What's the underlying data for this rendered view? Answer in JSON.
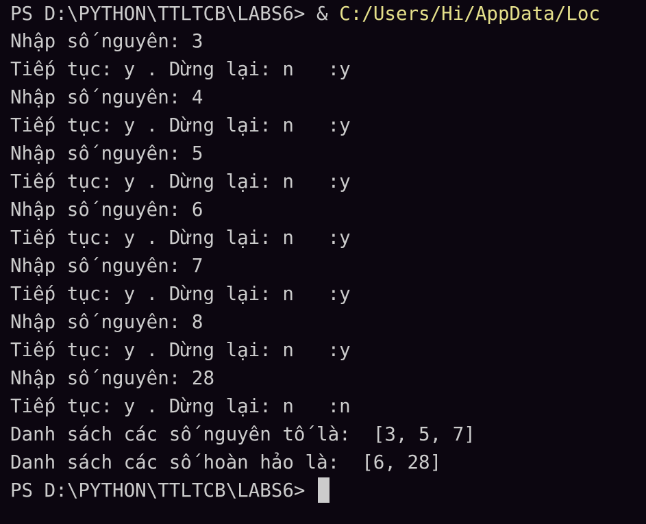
{
  "terminal": {
    "prompt": "PS D:\\PYTHON\\TTLTCB\\LABS6> ",
    "command_operator": "& ",
    "command_path": "C:/Users/Hi/AppData/Loc",
    "output_lines": [
      "Nhập số nguyên: 3",
      "Tiếp tục: y . Dừng lại: n   :y",
      "Nhập số nguyên: 4",
      "Tiếp tục: y . Dừng lại: n   :y",
      "Nhập số nguyên: 5",
      "Tiếp tục: y . Dừng lại: n   :y",
      "Nhập số nguyên: 6",
      "Tiếp tục: y . Dừng lại: n   :y",
      "Nhập số nguyên: 7",
      "Tiếp tục: y . Dừng lại: n   :y",
      "Nhập số nguyên: 8",
      "Tiếp tục: y . Dừng lại: n   :y",
      "Nhập số nguyên: 28",
      "Tiếp tục: y . Dừng lại: n   :n",
      "Danh sách các số nguyên tố là:  [3, 5, 7]",
      "Danh sách các số hoàn hảo là:  [6, 28]"
    ],
    "final_prompt": "PS D:\\PYTHON\\TTLTCB\\LABS6> "
  },
  "colors": {
    "background": "#0c0610",
    "text": "#cccccc",
    "command_path": "#e5e08b"
  }
}
